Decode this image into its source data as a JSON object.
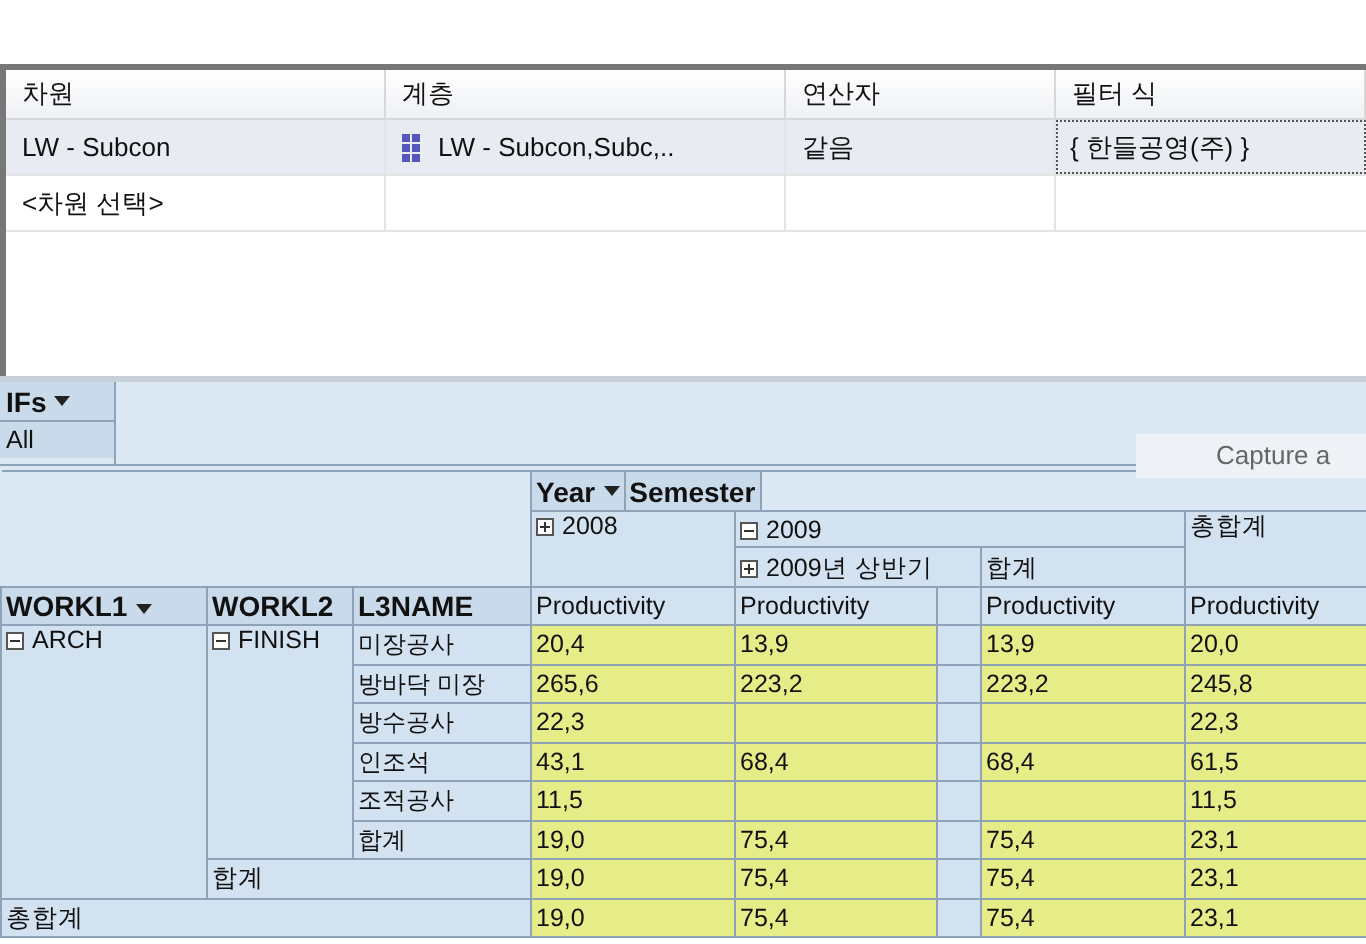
{
  "filter_grid": {
    "columns": [
      "차원",
      "계층",
      "연산자",
      "필터 식"
    ],
    "rows": [
      {
        "dimension": "LW - Subcon",
        "hierarchy": "LW - Subcon,Subc,..",
        "operator": "같음",
        "expression": "{ 한들공영(주) }",
        "selected": true
      },
      {
        "dimension": "<차원 선택>",
        "selected": false
      }
    ]
  },
  "pivot": {
    "filter_field": {
      "label": "IFs",
      "value": "All"
    },
    "capture_button": "Capture a",
    "column_fields": [
      "Year",
      "Semester"
    ],
    "years": [
      {
        "label": "2008",
        "expanded": false
      },
      {
        "label": "2009",
        "expanded": true,
        "children": [
          {
            "label": "2009년 상반기",
            "expanded": false
          },
          {
            "label": "합계"
          }
        ]
      }
    ],
    "grand_total_header": "총합계",
    "row_fields": [
      "WORKL1",
      "WORKL2",
      "L3NAME"
    ],
    "measure": [
      "Productivity",
      "Productivity",
      "Productivity",
      "Productivity"
    ],
    "groups": [
      {
        "label": "ARCH",
        "expanded": true,
        "children": [
          {
            "label": "FINISH",
            "expanded": true,
            "rows": [
              {
                "label": "미장공사",
                "values": [
                  "20,4",
                  "13,9",
                  "13,9",
                  "20,0"
                ]
              },
              {
                "label": "방바닥 미장",
                "values": [
                  "265,6",
                  "223,2",
                  "223,2",
                  "245,8"
                ]
              },
              {
                "label": "방수공사",
                "values": {
                  "y2008": "22,3",
                  "grand": "22,3"
                }
              },
              {
                "label": "인조석",
                "values": [
                  "43,1",
                  "68,4",
                  "68,4",
                  "61,5"
                ]
              },
              {
                "label": "조적공사",
                "values": {
                  "y2008": "11,5",
                  "grand": "11,5"
                }
              },
              {
                "label": "합계",
                "values": [
                  "19,0",
                  "75,4",
                  "75,4",
                  "23,1"
                ]
              }
            ]
          }
        ],
        "total": {
          "label": "합계",
          "values": [
            "19,0",
            "75,4",
            "75,4",
            "23,1"
          ]
        }
      }
    ],
    "grand_total": {
      "label": "총합계",
      "values": [
        "19,0",
        "75,4",
        "75,4",
        "23,1"
      ]
    }
  }
}
